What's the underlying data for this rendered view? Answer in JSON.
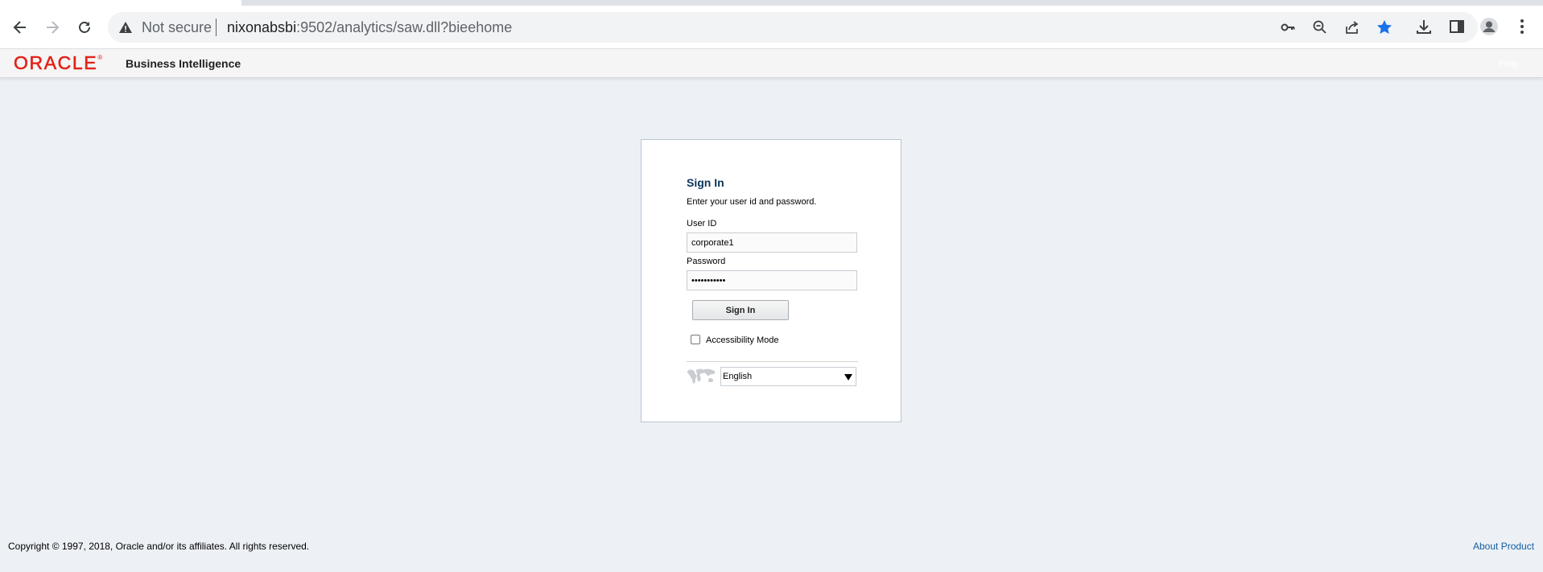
{
  "browser": {
    "security_label": "Not secure",
    "url_host": "nixonabsbi",
    "url_rest": ":9502/analytics/saw.dll?bieehome"
  },
  "header": {
    "logo_text": "ORACLE",
    "logo_mark": "®",
    "product": "Business Intelligence",
    "help": "Help"
  },
  "signin": {
    "title": "Sign In",
    "instruction": "Enter your user id and password.",
    "userid_label": "User ID",
    "userid_value": "corporate1",
    "password_label": "Password",
    "password_value": "Oracle12345",
    "button": "Sign In",
    "accessibility_label": "Accessibility Mode",
    "accessibility_checked": false,
    "language_selected": "English"
  },
  "footer": {
    "copyright": "Copyright © 1997, 2018, Oracle and/or its affiliates. All rights reserved.",
    "about": "About Product"
  },
  "colors": {
    "page_bg": "#edf1f5",
    "oracle_red": "#e2231a",
    "title_blue": "#0c3559",
    "link_blue": "#145c9e",
    "bookmark_star": "#1a73e8"
  },
  "icons": [
    "back-arrow-icon",
    "forward-arrow-icon",
    "reload-icon",
    "warning-icon",
    "key-icon",
    "zoom-out-icon",
    "share-icon",
    "bookmark-star-icon",
    "download-icon",
    "side-panel-icon",
    "profile-icon",
    "menu-kebab-icon",
    "globe-map-icon",
    "dropdown-caret-icon"
  ]
}
